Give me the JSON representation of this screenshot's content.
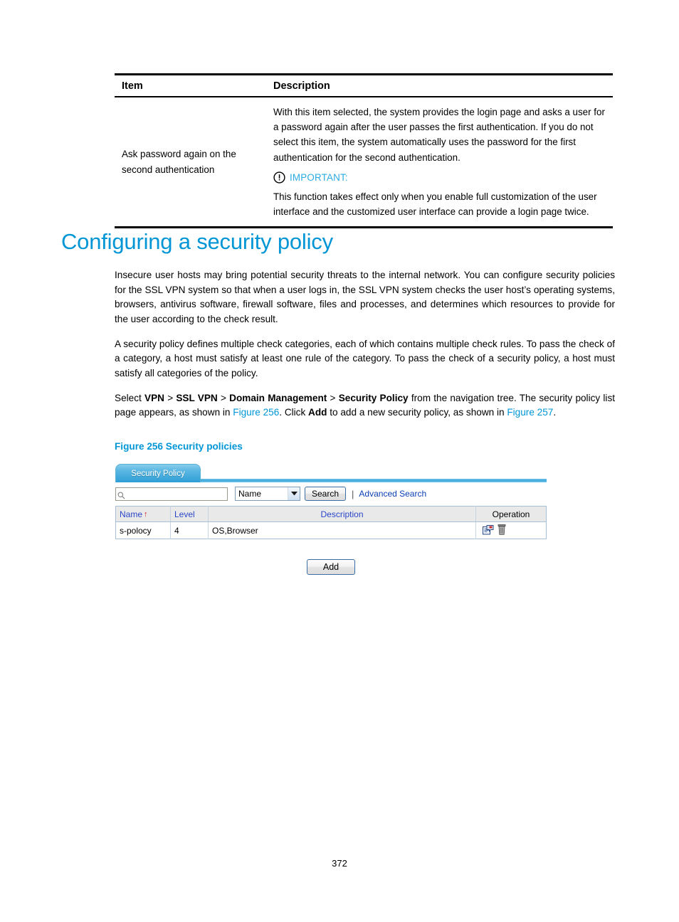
{
  "reference_table": {
    "headers": {
      "item": "Item",
      "description": "Description"
    },
    "rows": [
      {
        "item": "Ask password again on the second authentication",
        "description_paragraph": "With this item selected, the system provides the login page and asks a user for a password again after the user passes the first authentication. If you do not select this item, the system automatically uses the password for the first authentication for the second authentication.",
        "note_label": "IMPORTANT:",
        "note_text": "This function takes effect only when you enable full customization of the user interface and the customized user interface can provide a login page twice."
      }
    ]
  },
  "section": {
    "heading": "Configuring a security policy",
    "paragraph_1": "Insecure user hosts may bring potential security threats to the internal network. You can configure security policies for the SSL VPN system so that when a user logs in, the SSL VPN system checks the user host’s operating systems, browsers, antivirus software, firewall software, files and processes, and determines which resources to provide for the user according to the check result.",
    "paragraph_2": "A security policy defines multiple check categories, each of which contains multiple check rules. To pass the check of a category, a host must satisfy at least one rule of the category. To pass the check of a security policy, a host must satisfy all categories of the policy.",
    "paragraph_3": {
      "t1": "Select ",
      "b1": "VPN",
      "t2": " > ",
      "b2": "SSL VPN",
      "t3": " > ",
      "b3": "Domain Management",
      "t4": " > ",
      "b4": "Security Policy",
      "t5": " from the navigation tree. The security policy list page appears, as shown in ",
      "x1": "Figure 256",
      "t6": ". Click ",
      "b5": "Add",
      "t7": " to add a new security policy, as shown in ",
      "x2": "Figure 257",
      "t8": "."
    },
    "figure_caption": "Figure 256 Security policies"
  },
  "ui_figure": {
    "tab": {
      "label": "Security Policy"
    },
    "search": {
      "input_value": "",
      "input_placeholder": "",
      "select_value": "Name",
      "search_button": "Search",
      "separator": "|",
      "advanced_search_link": "Advanced Search"
    },
    "table": {
      "columns": [
        "Name",
        "Level",
        "Description",
        "Operation"
      ],
      "sort_indicator": "↑",
      "sorted_column": "Name",
      "rows": [
        {
          "name": "s-polocy",
          "level": "4",
          "description": "OS,Browser",
          "operations": [
            "edit-icon",
            "delete-icon"
          ]
        }
      ]
    },
    "add_button": "Add"
  },
  "footer": {
    "page_number": "372"
  },
  "colors": {
    "heading_blue": "#0096d6",
    "link_blue": "#0b3fb5",
    "important_cyan": "#29abe2",
    "tab_blue": "#2e9fd6",
    "sort_arrow_red": "#d02020",
    "table_header_text": "#2b46c7"
  }
}
